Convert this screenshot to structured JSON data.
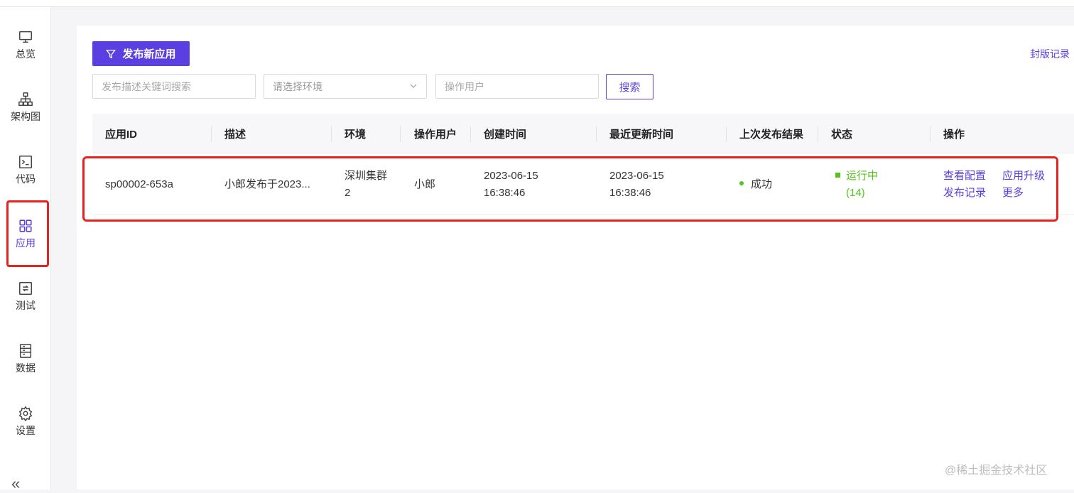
{
  "sidebar": {
    "items": [
      {
        "label": "总览",
        "icon": "monitor-icon"
      },
      {
        "label": "架构图",
        "icon": "architecture-icon"
      },
      {
        "label": "代码",
        "icon": "terminal-icon"
      },
      {
        "label": "应用",
        "icon": "apps-grid-icon",
        "active": true
      },
      {
        "label": "测试",
        "icon": "test-cycle-icon"
      },
      {
        "label": "数据",
        "icon": "database-icon"
      },
      {
        "label": "设置",
        "icon": "gear-icon"
      }
    ],
    "collapse_label": "«"
  },
  "toolbar": {
    "publish_button": "发布新应用",
    "seal_link": "封版记录",
    "search_button": "搜索"
  },
  "filters": {
    "keyword_placeholder": "发布描述关键词搜索",
    "env_placeholder": "请选择环境",
    "user_placeholder": "操作用户"
  },
  "table": {
    "headers": [
      "应用ID",
      "描述",
      "环境",
      "操作用户",
      "创建时间",
      "最近更新时间",
      "上次发布结果",
      "状态",
      "操作"
    ],
    "rows": [
      {
        "app_id": "sp00002-653a",
        "description": "小郎发布于2023...",
        "env_line1": "深圳集群",
        "env_line2": "2",
        "user": "小郎",
        "created_date": "2023-06-15",
        "created_time": "16:38:46",
        "updated_date": "2023-06-15",
        "updated_time": "16:38:46",
        "last_result": "成功",
        "status_line1": "运行中",
        "status_line2": "(14)",
        "actions": [
          "查看配置",
          "应用升级",
          "发布记录",
          "更多"
        ]
      }
    ]
  },
  "colors": {
    "accent": "#5b3fe0",
    "success": "#52c41a",
    "highlight": "#e8231f"
  },
  "watermark": "@稀土掘金技术社区"
}
